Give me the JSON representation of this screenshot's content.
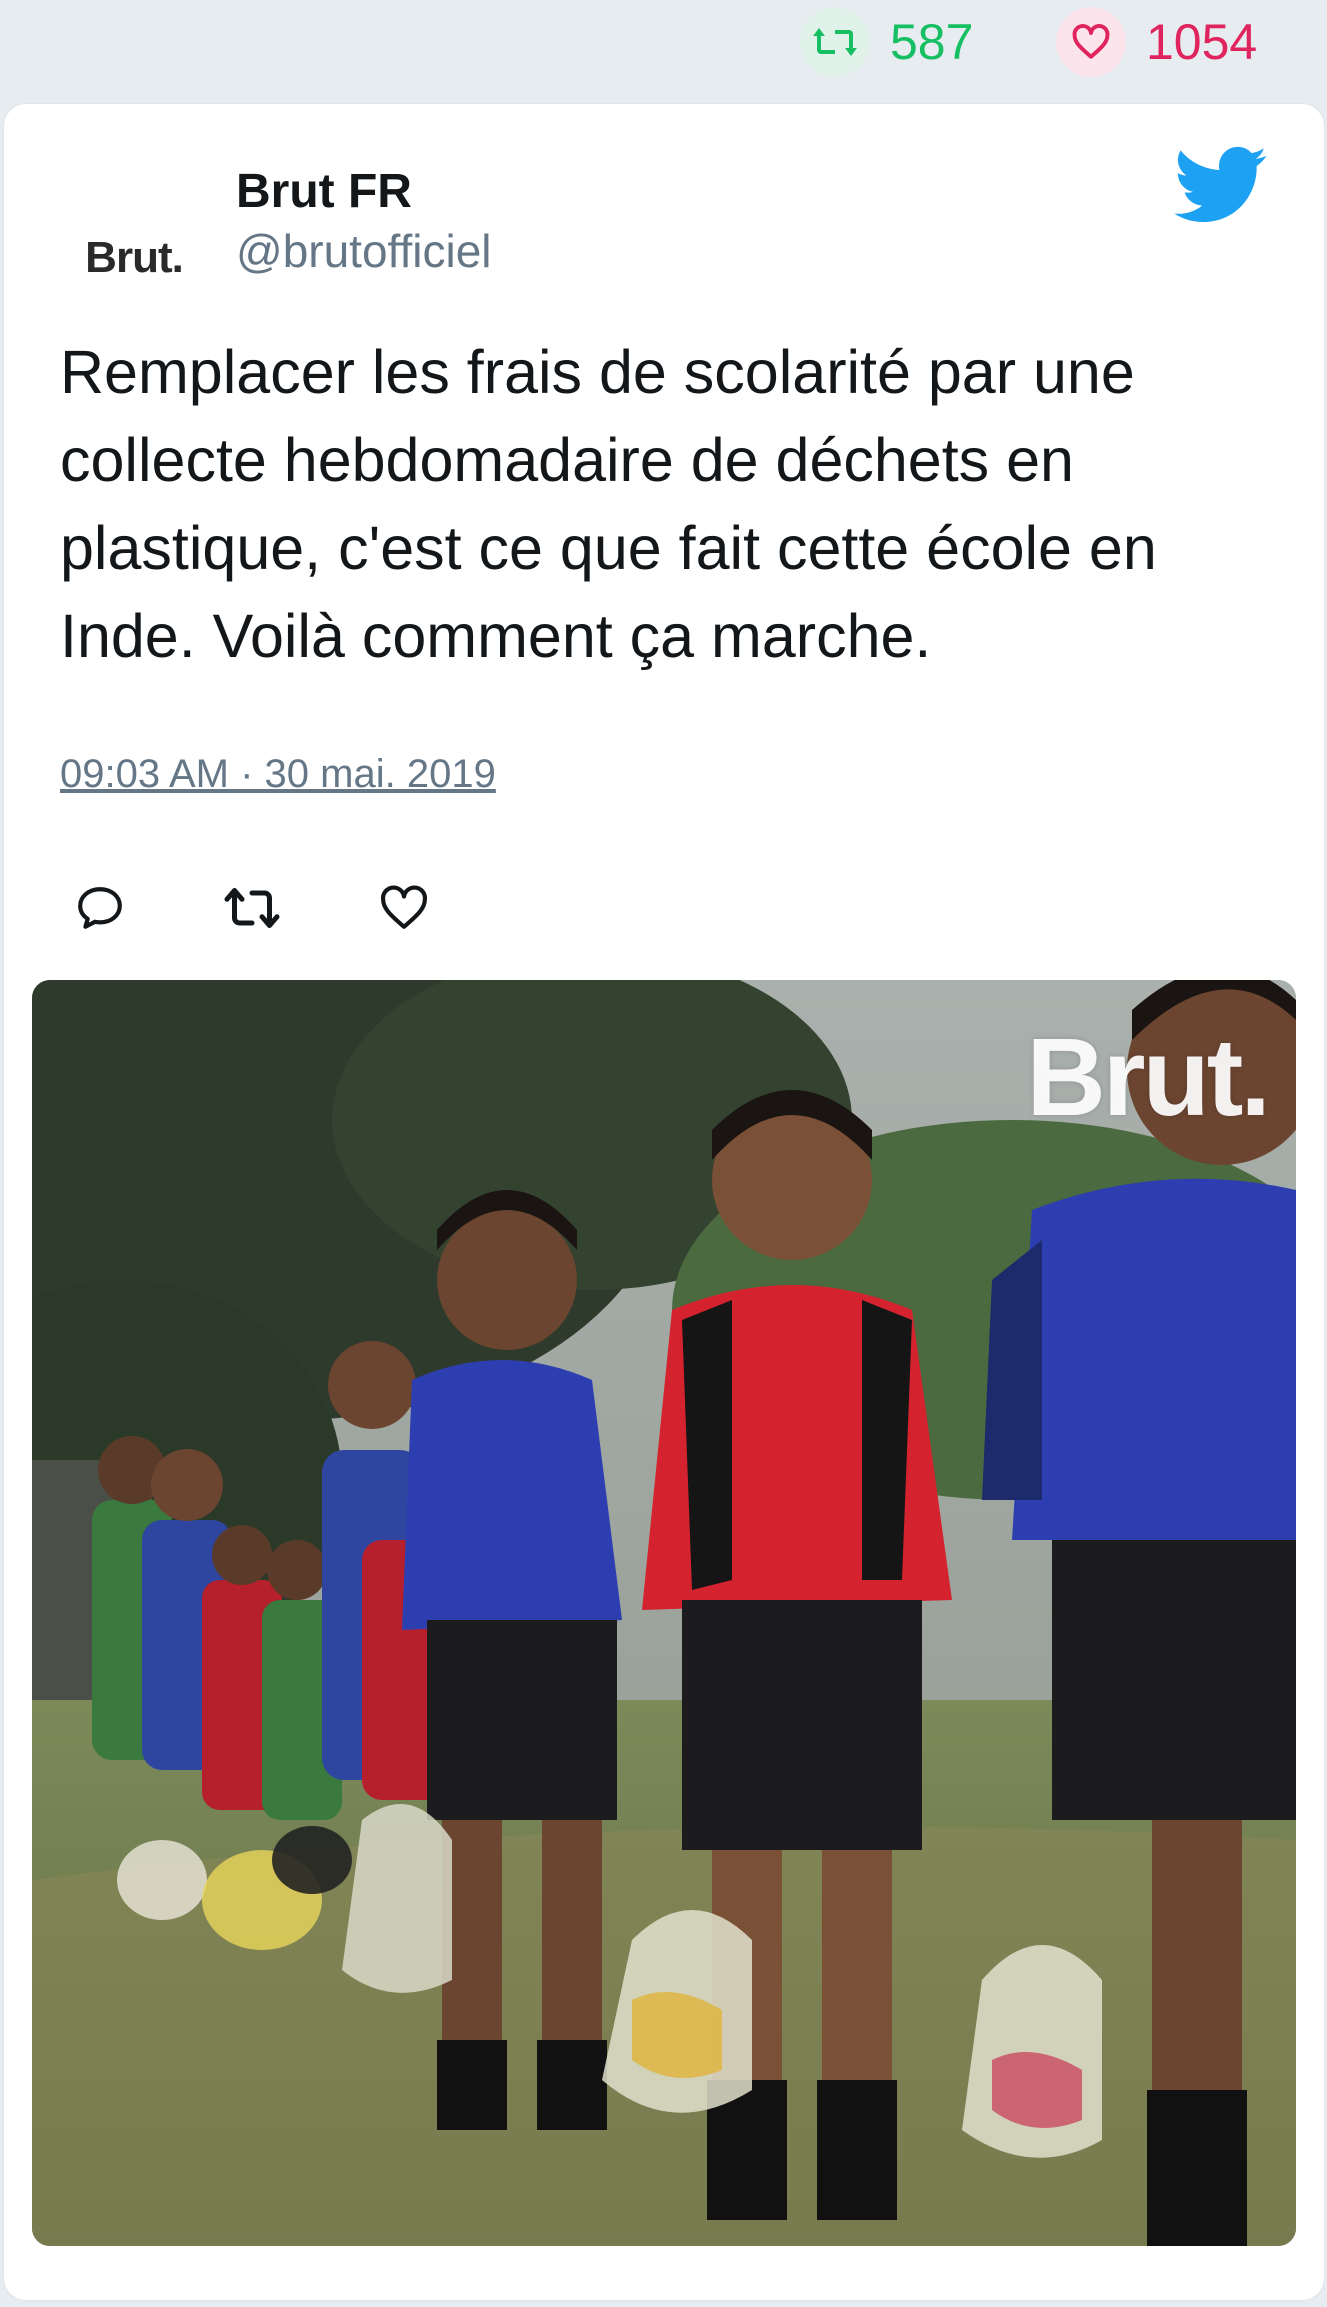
{
  "stats": {
    "retweet_count": "587",
    "like_count": "1054"
  },
  "author": {
    "avatar_text": "Brut.",
    "display_name": "Brut FR",
    "handle": "@brutofficiel"
  },
  "tweet": {
    "text": "Remplacer les frais de scolarité par une collecte hebdomadaire de déchets en plastique, c'est ce que fait cette école en Inde. Voilà comment ça marche.",
    "timestamp": "09:03 AM · 30 mai. 2019"
  },
  "media": {
    "watermark": "Brut."
  },
  "icons": {
    "retweet": "retweet-icon",
    "like": "heart-icon",
    "reply": "reply-icon",
    "twitter": "twitter-bird-icon"
  },
  "colors": {
    "retweet_green": "#17bf63",
    "like_red": "#e0245e",
    "twitter_blue": "#1da1f2",
    "text": "#14171a",
    "muted": "#657786",
    "background": "#e6ecf0"
  }
}
